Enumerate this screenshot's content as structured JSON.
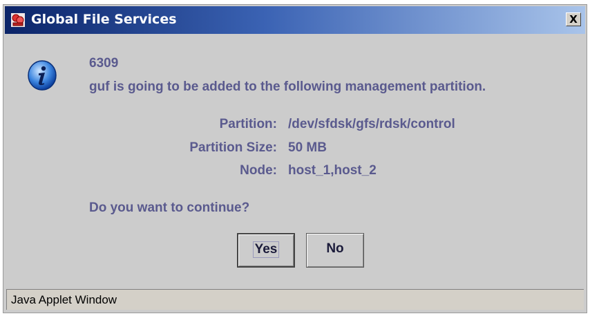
{
  "window": {
    "title": "Global File Services",
    "close_label": "X",
    "title_gradient_start": "#0b2468",
    "title_gradient_end": "#a9c4ea"
  },
  "message": {
    "icon": "information-icon",
    "code": "6309",
    "text": "guf is going to be added to the following management partition.",
    "details": [
      {
        "label": "Partition:",
        "value": "/dev/sfdsk/gfs/rdsk/control"
      },
      {
        "label": "Partition Size:",
        "value": "50 MB"
      },
      {
        "label": "Node:",
        "value": "host_1,host_2"
      }
    ],
    "question": "Do you want to continue?",
    "text_color": "#5a5a8e"
  },
  "buttons": {
    "yes_label": "Yes",
    "no_label": "No"
  },
  "status": {
    "text": "Java Applet Window"
  }
}
